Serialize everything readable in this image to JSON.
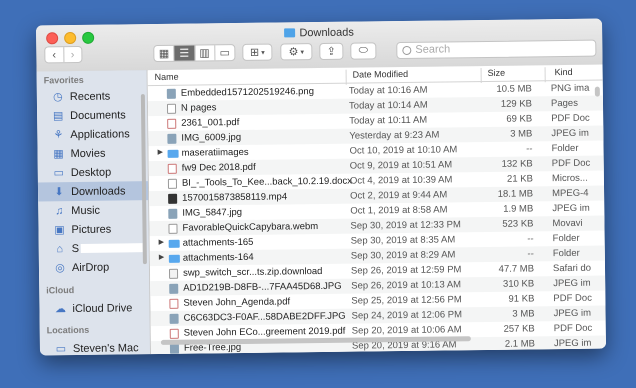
{
  "window": {
    "title": "Downloads"
  },
  "toolbar": {
    "back": "‹",
    "forward": "›",
    "search_placeholder": "Search",
    "action": "⚙",
    "share": "⇪",
    "group": "⊞"
  },
  "sidebar": {
    "favorites_heading": "Favorites",
    "items": [
      {
        "label": "Recents",
        "icon": "clock-icon",
        "glyph": "◷"
      },
      {
        "label": "Documents",
        "icon": "document-icon",
        "glyph": "▤"
      },
      {
        "label": "Applications",
        "icon": "applications-icon",
        "glyph": "⚘"
      },
      {
        "label": "Movies",
        "icon": "film-icon",
        "glyph": "▦"
      },
      {
        "label": "Desktop",
        "icon": "desktop-icon",
        "glyph": "▭"
      },
      {
        "label": "Downloads",
        "icon": "download-icon",
        "glyph": "⬇"
      },
      {
        "label": "Music",
        "icon": "music-icon",
        "glyph": "♫"
      },
      {
        "label": "Pictures",
        "icon": "camera-icon",
        "glyph": "▣"
      },
      {
        "label": "S",
        "icon": "home-icon",
        "glyph": "⌂"
      },
      {
        "label": "AirDrop",
        "icon": "airdrop-icon",
        "glyph": "◎"
      }
    ],
    "icloud_heading": "iCloud",
    "icloud_drive": "iCloud Drive",
    "locations_heading": "Locations",
    "location_item": "Steven's Mac"
  },
  "columns": {
    "name": "Name",
    "date": "Date Modified",
    "size": "Size",
    "kind": "Kind"
  },
  "files": [
    {
      "disc": "",
      "type": "img",
      "name": "Embedded1571202519246.png",
      "date": "Today at 10:16 AM",
      "size": "10.5 MB",
      "kind": "PNG ima"
    },
    {
      "disc": "",
      "type": "doc",
      "name": "N                   pages",
      "date": "Today at 10:14 AM",
      "size": "129 KB",
      "kind": "Pages"
    },
    {
      "disc": "",
      "type": "pdf",
      "name": "2361_001.pdf",
      "date": "Today at 10:11 AM",
      "size": "69 KB",
      "kind": "PDF Doc"
    },
    {
      "disc": "",
      "type": "img",
      "name": "IMG_6009.jpg",
      "date": "Yesterday at 9:23 AM",
      "size": "3 MB",
      "kind": "JPEG im"
    },
    {
      "disc": "▶",
      "type": "folder",
      "name": "maseratiimages",
      "date": "Oct 10, 2019 at 10:10 AM",
      "size": "--",
      "kind": "Folder"
    },
    {
      "disc": "",
      "type": "pdf",
      "name": "fw9 Dec 2018.pdf",
      "date": "Oct 9, 2019 at 10:51 AM",
      "size": "132 KB",
      "kind": "PDF Doc"
    },
    {
      "disc": "",
      "type": "doc",
      "name": "BI_-_Tools_To_Kee...back_10.2.19.docx",
      "date": "Oct 4, 2019 at 10:39 AM",
      "size": "21 KB",
      "kind": "Micros..."
    },
    {
      "disc": "",
      "type": "vid",
      "name": "1570015873858119.mp4",
      "date": "Oct 2, 2019 at 9:44 AM",
      "size": "18.1 MB",
      "kind": "MPEG-4"
    },
    {
      "disc": "",
      "type": "img",
      "name": "IMG_5847.jpg",
      "date": "Oct 1, 2019 at 8:58 AM",
      "size": "1.9 MB",
      "kind": "JPEG im"
    },
    {
      "disc": "",
      "type": "doc",
      "name": "FavorableQuickCapybara.webm",
      "date": "Sep 30, 2019 at 12:33 PM",
      "size": "523 KB",
      "kind": "Movavi"
    },
    {
      "disc": "▶",
      "type": "folder",
      "name": "attachments-165",
      "date": "Sep 30, 2019 at 8:35 AM",
      "size": "--",
      "kind": "Folder"
    },
    {
      "disc": "▶",
      "type": "folder",
      "name": "attachments-164",
      "date": "Sep 30, 2019 at 8:29 AM",
      "size": "--",
      "kind": "Folder"
    },
    {
      "disc": "",
      "type": "dl",
      "name": "swp_switch_scr...ts.zip.download",
      "date": "Sep 26, 2019 at 12:59 PM",
      "size": "47.7 MB",
      "kind": "Safari do"
    },
    {
      "disc": "",
      "type": "img",
      "name": "AD1D219B-D8FB-...7FAA45D68.JPG",
      "date": "Sep 26, 2019 at 10:13 AM",
      "size": "310 KB",
      "kind": "JPEG im"
    },
    {
      "disc": "",
      "type": "pdf",
      "name": "Steven John_Agenda.pdf",
      "date": "Sep 25, 2019 at 12:56 PM",
      "size": "91 KB",
      "kind": "PDF Doc"
    },
    {
      "disc": "",
      "type": "img",
      "name": "C6C63DC3-F0AF...58DABE2DFF.JPG",
      "date": "Sep 24, 2019 at 12:06 PM",
      "size": "3 MB",
      "kind": "JPEG im"
    },
    {
      "disc": "",
      "type": "pdf",
      "name": "Steven John ECo...greement 2019.pdf",
      "date": "Sep 20, 2019 at 10:06 AM",
      "size": "257 KB",
      "kind": "PDF Doc"
    },
    {
      "disc": "",
      "type": "img",
      "name": "Free-Tree.jpg",
      "date": "Sep 20, 2019 at 9:16 AM",
      "size": "2.1 MB",
      "kind": "JPEG im"
    }
  ]
}
